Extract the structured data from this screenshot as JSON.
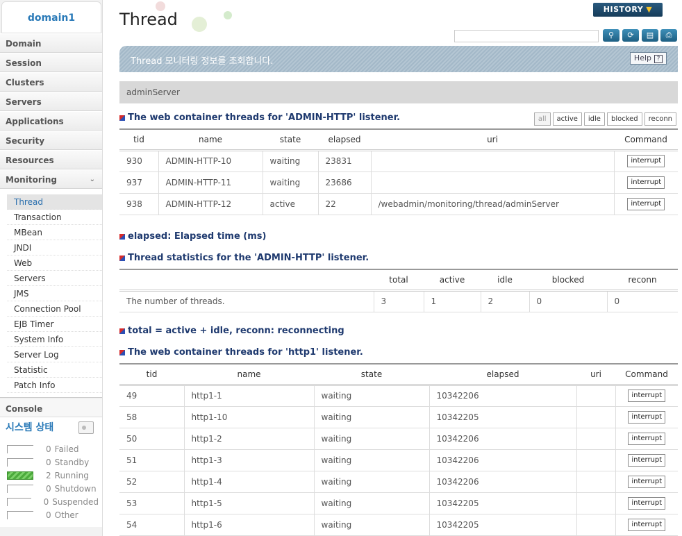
{
  "sidebar": {
    "domain": "domain1",
    "menu": [
      "Domain",
      "Session",
      "Clusters",
      "Servers",
      "Applications",
      "Security",
      "Resources",
      "Monitoring"
    ],
    "submenu": [
      "Thread",
      "Transaction",
      "MBean",
      "JNDI",
      "Web",
      "Servers",
      "JMS",
      "Connection Pool",
      "EJB Timer",
      "System Info",
      "Server Log",
      "Statistic",
      "Patch Info"
    ],
    "active_submenu": "Thread",
    "console": "Console",
    "system_status_title": "시스템 상태",
    "status": [
      {
        "count": "0",
        "label": "Failed"
      },
      {
        "count": "0",
        "label": "Standby"
      },
      {
        "count": "2",
        "label": "Running"
      },
      {
        "count": "0",
        "label": "Shutdown"
      },
      {
        "count": "0",
        "label": "Suspended"
      },
      {
        "count": "0",
        "label": "Other"
      }
    ]
  },
  "header": {
    "title": "Thread",
    "history_label": "HISTORY",
    "search_value": "",
    "banner_text": "Thread 모니터링 정보를 조회합니다.",
    "help_label": "Help"
  },
  "server_name": "adminServer",
  "section1": {
    "title": "The web container threads for 'ADMIN-HTTP' listener.",
    "filters": [
      "all",
      "active",
      "idle",
      "blocked",
      "reconn"
    ],
    "columns": [
      "tid",
      "name",
      "state",
      "elapsed",
      "uri",
      "Command"
    ],
    "rows": [
      {
        "tid": "930",
        "name": "ADMIN-HTTP-10",
        "state": "waiting",
        "elapsed": "23831",
        "uri": "",
        "command": "interrupt"
      },
      {
        "tid": "937",
        "name": "ADMIN-HTTP-11",
        "state": "waiting",
        "elapsed": "23686",
        "uri": "",
        "command": "interrupt"
      },
      {
        "tid": "938",
        "name": "ADMIN-HTTP-12",
        "state": "active",
        "elapsed": "22",
        "uri": "/webadmin/monitoring/thread/adminServer",
        "command": "interrupt"
      }
    ]
  },
  "note_elapsed": "elapsed: Elapsed time (ms)",
  "section2": {
    "title": "Thread statistics for the 'ADMIN-HTTP' listener.",
    "columns": [
      "",
      "total",
      "active",
      "idle",
      "blocked",
      "reconn"
    ],
    "row": {
      "label": "The number of threads.",
      "total": "3",
      "active": "1",
      "idle": "2",
      "blocked": "0",
      "reconn": "0"
    }
  },
  "note_total": "total = active + idle, reconn: reconnecting",
  "section3": {
    "title": "The web container threads for 'http1' listener.",
    "columns": [
      "tid",
      "name",
      "state",
      "elapsed",
      "uri",
      "Command"
    ],
    "rows": [
      {
        "tid": "49",
        "name": "http1-1",
        "state": "waiting",
        "elapsed": "10342206",
        "uri": "",
        "command": "interrupt"
      },
      {
        "tid": "58",
        "name": "http1-10",
        "state": "waiting",
        "elapsed": "10342205",
        "uri": "",
        "command": "interrupt"
      },
      {
        "tid": "50",
        "name": "http1-2",
        "state": "waiting",
        "elapsed": "10342206",
        "uri": "",
        "command": "interrupt"
      },
      {
        "tid": "51",
        "name": "http1-3",
        "state": "waiting",
        "elapsed": "10342206",
        "uri": "",
        "command": "interrupt"
      },
      {
        "tid": "52",
        "name": "http1-4",
        "state": "waiting",
        "elapsed": "10342206",
        "uri": "",
        "command": "interrupt"
      },
      {
        "tid": "53",
        "name": "http1-5",
        "state": "waiting",
        "elapsed": "10342205",
        "uri": "",
        "command": "interrupt"
      },
      {
        "tid": "54",
        "name": "http1-6",
        "state": "waiting",
        "elapsed": "10342205",
        "uri": "",
        "command": "interrupt"
      }
    ]
  }
}
